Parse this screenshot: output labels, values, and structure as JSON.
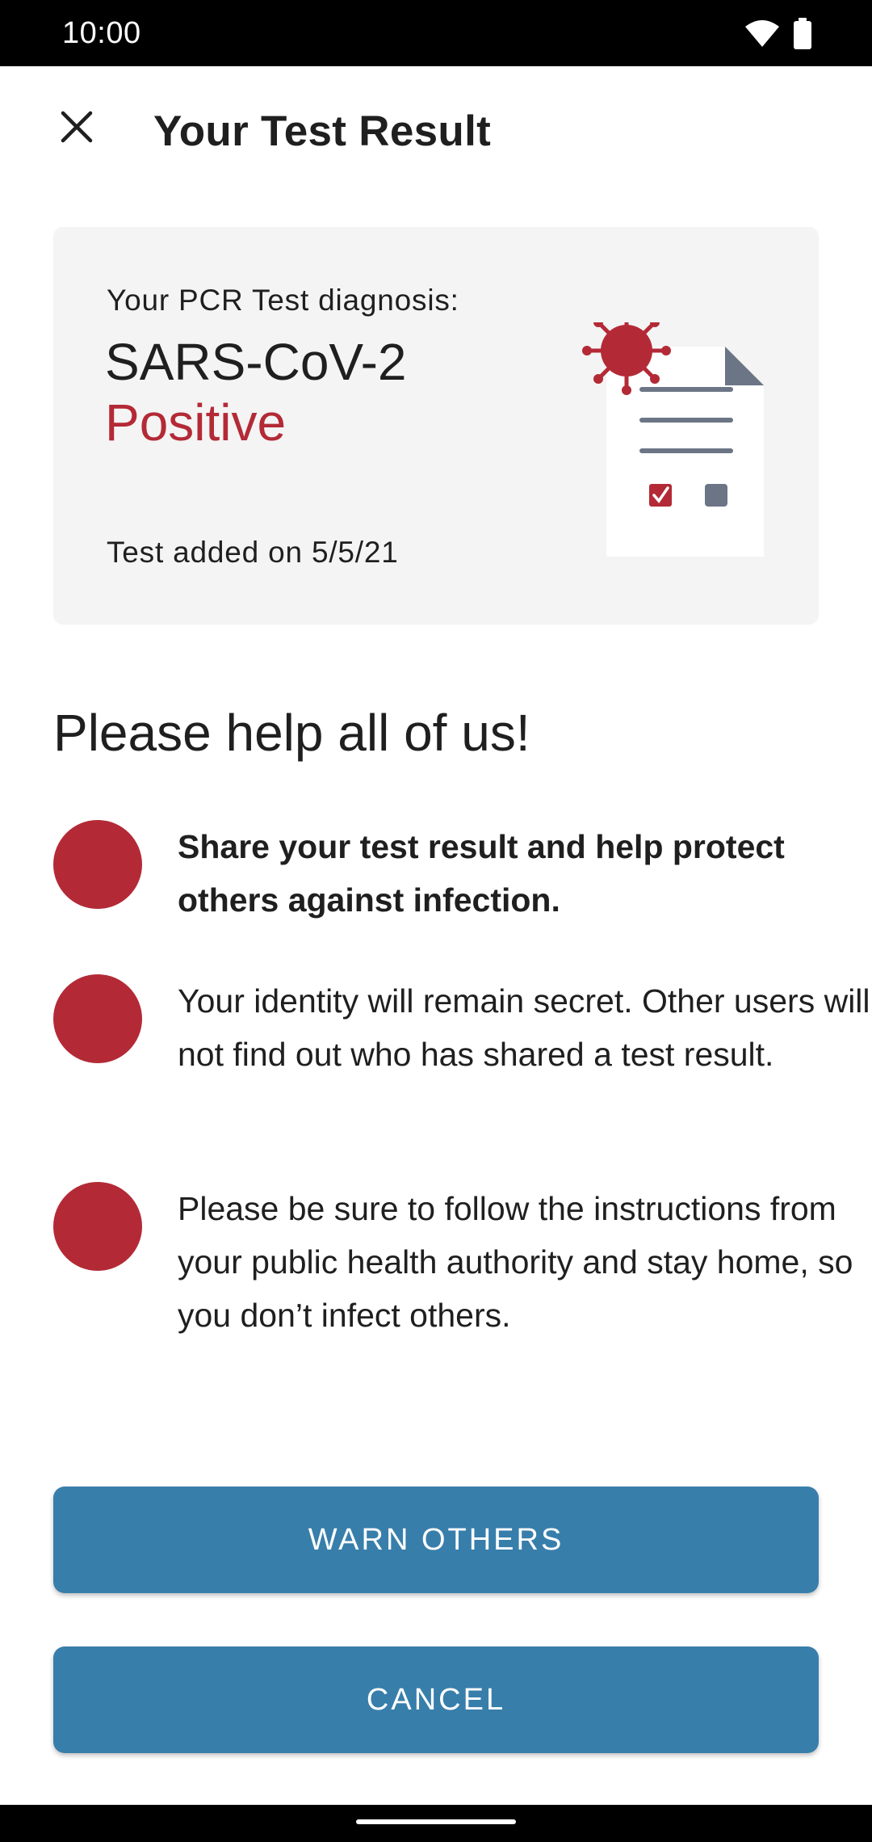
{
  "status_bar": {
    "time": "10:00"
  },
  "app_bar": {
    "title": "Your Test Result"
  },
  "result_card": {
    "caption": "Your PCR Test diagnosis:",
    "virus_name": "SARS-CoV-2",
    "result": "Positive",
    "date_text": "Test added on 5/5/21"
  },
  "help_section": {
    "title": "Please help all of us!",
    "items": [
      {
        "text": "Share your test result and help protect others against infection."
      },
      {
        "text": "Your identity will remain secret. Other users will not find out who has shared a test result."
      },
      {
        "text": "Please be sure to follow the instructions from your public health authority and stay home, so you don’t infect others."
      }
    ]
  },
  "buttons": {
    "warn_label": "WARN OTHERS",
    "cancel_label": "CANCEL"
  },
  "colors": {
    "accent_red": "#b32a36",
    "button_blue": "#387eab",
    "card_background": "#f4f4f4"
  }
}
